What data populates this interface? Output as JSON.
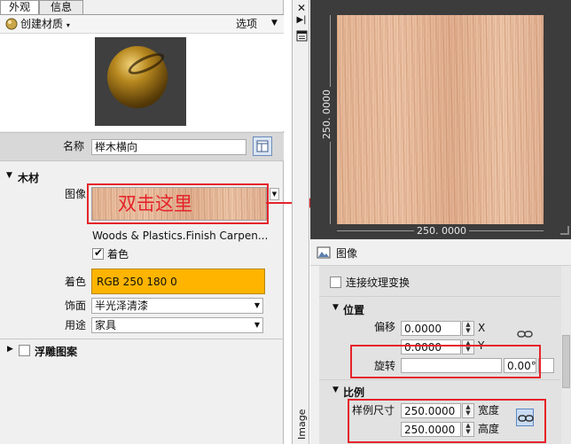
{
  "left_panel": {
    "tabs": [
      "外观",
      "信息"
    ],
    "toolbar": {
      "create_material": "创建材质",
      "options": "选项"
    },
    "name_label": "名称",
    "name_value": "榉木横向",
    "wood_section": "木材",
    "image_label": "图像",
    "image_overlay_text": "双击这里",
    "image_caption": "Woods & Plastics.Finish Carpen...",
    "tint_checkbox_label": "着色",
    "tint_checked": true,
    "tint_label": "着色",
    "tint_value": "RGB 250 180 0",
    "tint_color": "#ffb400",
    "finish_label": "饰面",
    "finish_value": "半光泽清漆",
    "use_label": "用途",
    "use_value": "家具",
    "relief_section": "浮雕图案"
  },
  "strip": {
    "vertical_label": "Image"
  },
  "right_panel": {
    "width_label": "250. 0000",
    "height_label": "250. 0000",
    "image_section": "图像",
    "link_transforms": "连接纹理变换",
    "position_section": "位置",
    "offset_label": "偏移",
    "offset_x": "0.0000",
    "offset_y": "0.0000",
    "x_axis": "X",
    "y_axis": "Y",
    "rotation_label": "旋转",
    "rotation_value": "0.00°",
    "scale_section": "比例",
    "sample_size_label": "样例尺寸",
    "width_value": "250.0000",
    "height_value": "250.0000",
    "width_text": "宽度",
    "height_text": "高度"
  },
  "colors": {
    "annotation_red": "#e5232a",
    "tint": "#ffb400"
  }
}
